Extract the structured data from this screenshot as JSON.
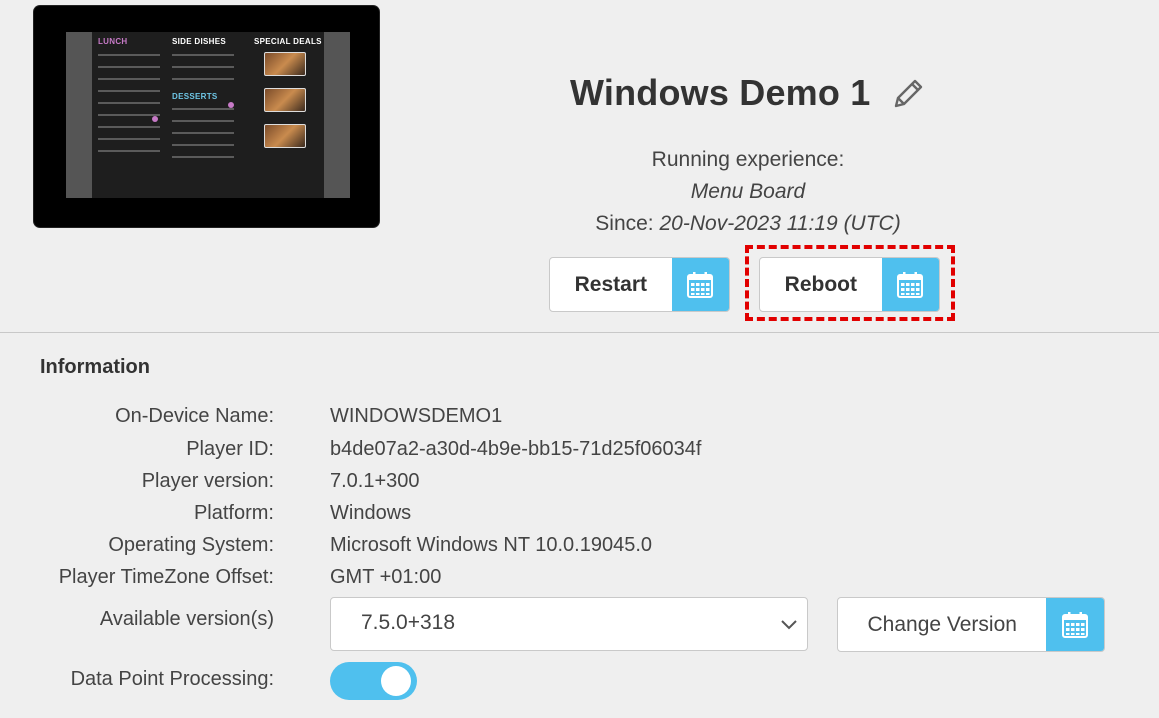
{
  "thumbnail": {
    "menu_headings": [
      "LUNCH",
      "SIDE DISHES",
      "SPECIAL DEALS",
      "DESSERTS"
    ],
    "heading_colors": [
      "#c77ac7",
      "#ffffff",
      "#ffffff",
      "#6ec6e6"
    ]
  },
  "header": {
    "device_name": "Windows Demo 1",
    "running_label": "Running experience:",
    "experience_name": "Menu Board",
    "since_label": "Since:",
    "since_value": "20-Nov-2023 11:19 (UTC)"
  },
  "actions": {
    "restart_label": "Restart",
    "reboot_label": "Reboot"
  },
  "information": {
    "title": "Information",
    "rows": [
      {
        "label": "On-Device Name:",
        "value": "WINDOWSDEMO1"
      },
      {
        "label": "Player ID:",
        "value": "b4de07a2-a30d-4b9e-bb15-71d25f06034f"
      },
      {
        "label": "Player version:",
        "value": "7.0.1+300"
      },
      {
        "label": "Platform:",
        "value": "Windows"
      },
      {
        "label": "Operating System:",
        "value": "Microsoft Windows NT 10.0.19045.0"
      },
      {
        "label": "Player TimeZone Offset:",
        "value": "GMT +01:00"
      }
    ],
    "available_versions_label": "Available version(s)",
    "selected_version": "7.5.0+318",
    "change_version_label": "Change Version",
    "data_point_label": "Data Point Processing:",
    "data_point_enabled": true
  },
  "colors": {
    "accent": "#4fc0ee",
    "highlight": "#e10000",
    "background": "#efefef"
  },
  "icons": {
    "edit": "pencil-icon",
    "schedule": "calendar-icon",
    "dropdown": "chevron-down-icon"
  }
}
